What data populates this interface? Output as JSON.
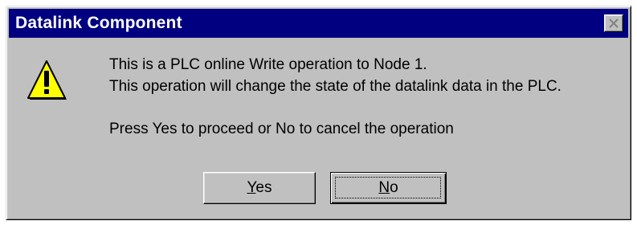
{
  "window": {
    "title": "Datalink Component",
    "close_icon": "close-icon"
  },
  "dialog": {
    "icon": "warning-icon",
    "message_line1": "This is a PLC online Write operation to Node 1.",
    "message_line2": "This operation will change the state of the datalink data in the PLC.",
    "message_line3": "Press Yes to proceed or No to cancel the operation"
  },
  "buttons": {
    "yes": {
      "mnemonic": "Y",
      "rest": "es"
    },
    "no": {
      "mnemonic": "N",
      "rest": "o"
    }
  },
  "colors": {
    "titlebar": "#000080",
    "face": "#c0c0c0",
    "warning_fill": "#ffff00"
  }
}
